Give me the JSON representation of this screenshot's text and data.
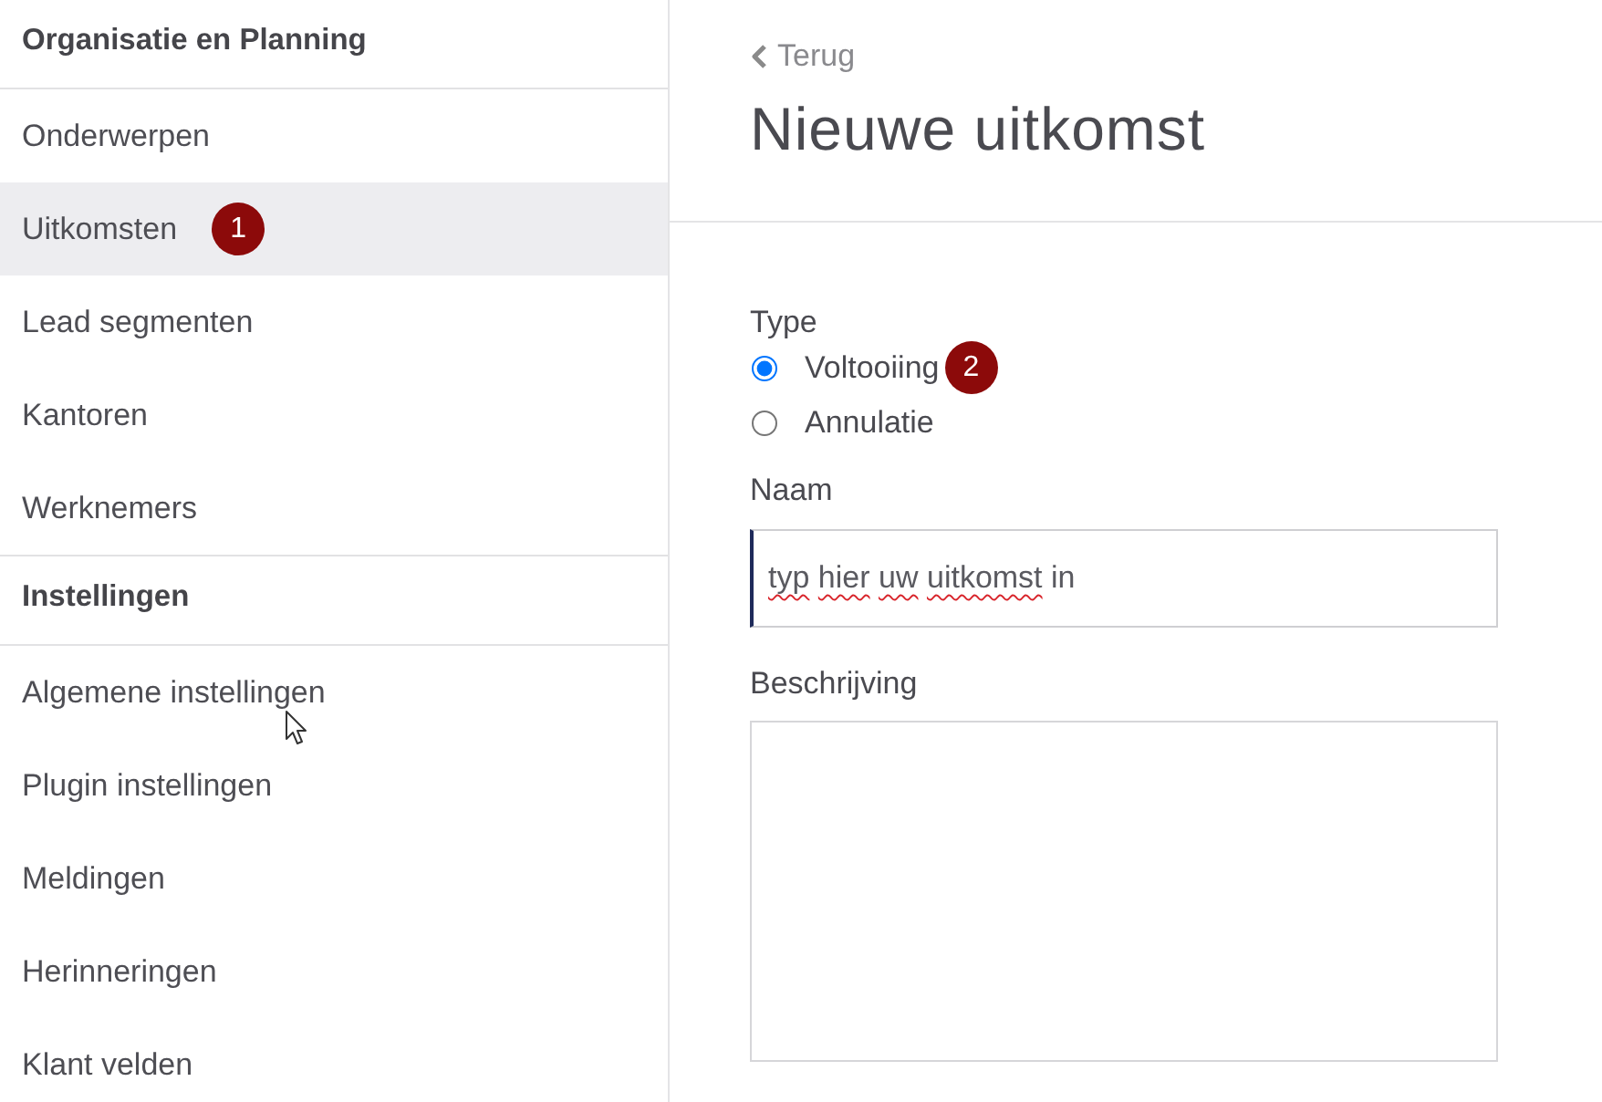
{
  "sidebar": {
    "sections": [
      {
        "title": "Organisatie en Planning",
        "items": [
          {
            "label": "Onderwerpen",
            "selected": false
          },
          {
            "label": "Uitkomsten",
            "selected": true,
            "badge": "1"
          },
          {
            "label": "Lead segmenten",
            "selected": false
          },
          {
            "label": "Kantoren",
            "selected": false
          },
          {
            "label": "Werknemers",
            "selected": false
          }
        ]
      },
      {
        "title": "Instellingen",
        "items": [
          {
            "label": "Algemene instellingen",
            "selected": false
          },
          {
            "label": "Plugin instellingen",
            "selected": false
          },
          {
            "label": "Meldingen",
            "selected": false
          },
          {
            "label": "Herinneringen",
            "selected": false
          },
          {
            "label": "Klant velden",
            "selected": false
          }
        ]
      }
    ]
  },
  "main": {
    "back_link": "Terug",
    "title": "Nieuwe uitkomst",
    "form": {
      "type_field": {
        "label": "Type",
        "options": [
          {
            "label": "Voltooiing",
            "selected": true,
            "badge": "2"
          },
          {
            "label": "Annulatie",
            "selected": false
          }
        ]
      },
      "name_field": {
        "label": "Naam",
        "value": "typ hier uw uitkomst in",
        "focused": true
      },
      "description_field": {
        "label": "Beschrijving"
      }
    }
  }
}
